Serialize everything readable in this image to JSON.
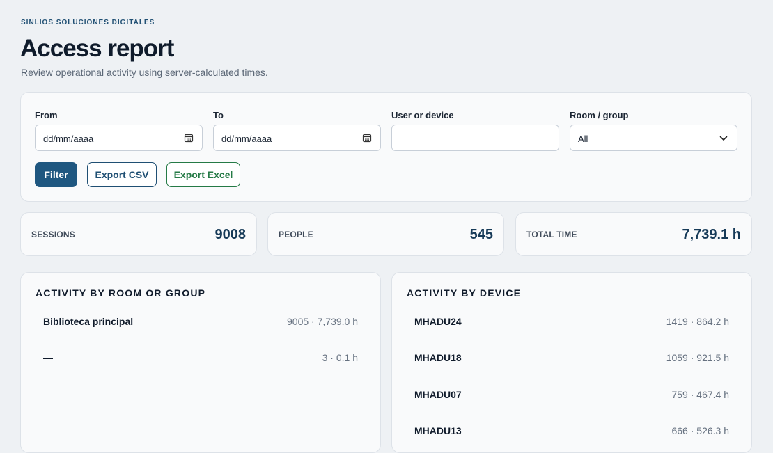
{
  "brand": "SINLIOS SOLUCIONES DIGITALES",
  "title": "Access report",
  "subtitle": "Review operational activity using server-calculated times.",
  "filters": {
    "from": {
      "label": "From",
      "placeholder": "dd/mm/aaaa",
      "icon": "calendar-icon"
    },
    "to": {
      "label": "To",
      "placeholder": "dd/mm/aaaa",
      "icon": "calendar-icon"
    },
    "user": {
      "label": "User or device",
      "value": ""
    },
    "room": {
      "label": "Room / group",
      "selected": "All",
      "icon": "chevron-down-icon"
    },
    "buttons": {
      "filter": "Filter",
      "csv": "Export CSV",
      "excel": "Export Excel"
    }
  },
  "stats": [
    {
      "label": "SESSIONS",
      "value": "9008"
    },
    {
      "label": "PEOPLE",
      "value": "545"
    },
    {
      "label": "TOTAL TIME",
      "value": "7,739.1 h"
    }
  ],
  "rooms": {
    "title": "ACTIVITY BY ROOM OR GROUP",
    "rows": [
      {
        "name": "Biblioteca principal",
        "meta": "9005 · 7,739.0 h"
      },
      {
        "name": "—",
        "meta": "3 · 0.1 h"
      }
    ]
  },
  "devices": {
    "title": "ACTIVITY BY DEVICE",
    "rows": [
      {
        "name": "MHADU24",
        "meta": "1419 · 864.2 h"
      },
      {
        "name": "MHADU18",
        "meta": "1059 · 921.5 h"
      },
      {
        "name": "MHADU07",
        "meta": "759 · 467.4 h"
      },
      {
        "name": "MHADU13",
        "meta": "666 · 526.3 h"
      }
    ]
  },
  "colors": {
    "accent": "#1f5780",
    "excel": "#257a46",
    "background": "#eef1f4"
  }
}
